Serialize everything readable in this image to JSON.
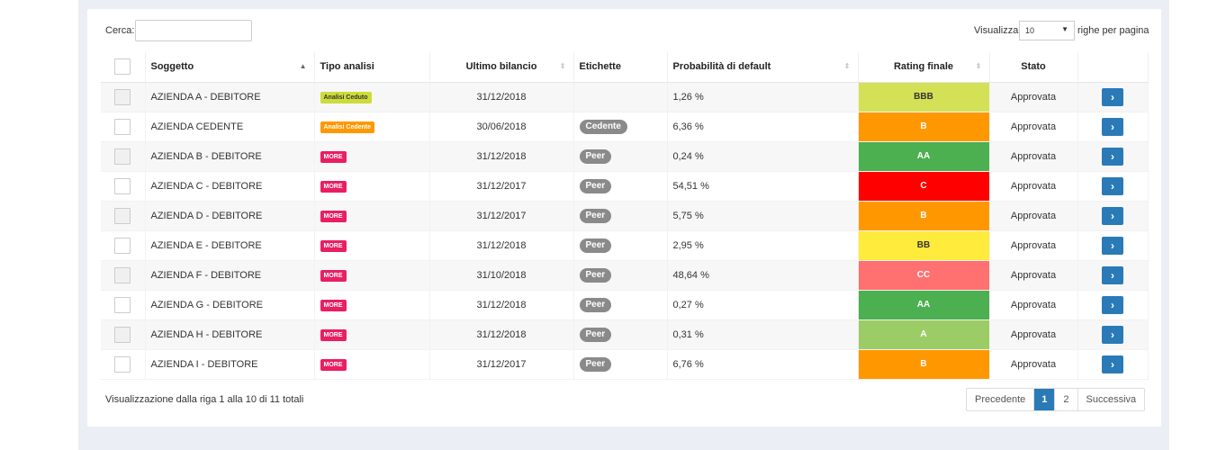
{
  "search": {
    "label": "Cerca:",
    "value": "",
    "placeholder": ""
  },
  "page_size": {
    "prefix": "Visualizza",
    "value": "10",
    "suffix": "righe per pagina"
  },
  "columns": {
    "soggetto": "Soggetto",
    "tipo": "Tipo analisi",
    "bilancio": "Ultimo bilancio",
    "etichette": "Etichette",
    "prob": "Probabilità di default",
    "rating": "Rating finale",
    "stato": "Stato"
  },
  "rows": [
    {
      "soggetto": "AZIENDA A - DEBITORE",
      "tipo": "Analisi Ceduto",
      "tipo_color": "#cddc39",
      "bilancio": "31/12/2018",
      "etichetta": "",
      "prob": "1,26 %",
      "rating": "BBB",
      "rating_color": "#d4e157",
      "rating_text": "#333333",
      "stato": "Approvata"
    },
    {
      "soggetto": "AZIENDA CEDENTE",
      "tipo": "Analisi Cedente",
      "tipo_color": "#ff9800",
      "bilancio": "30/06/2018",
      "etichetta": "Cedente",
      "prob": "6,36 %",
      "rating": "B",
      "rating_color": "#ff9800",
      "rating_text": "#ffffff",
      "stato": "Approvata"
    },
    {
      "soggetto": "AZIENDA B - DEBITORE",
      "tipo": "MORE",
      "tipo_color": "#e91e63",
      "bilancio": "31/12/2018",
      "etichetta": "Peer",
      "prob": "0,24 %",
      "rating": "AA",
      "rating_color": "#4caf50",
      "rating_text": "#ffffff",
      "stato": "Approvata"
    },
    {
      "soggetto": "AZIENDA C - DEBITORE",
      "tipo": "MORE",
      "tipo_color": "#e91e63",
      "bilancio": "31/12/2017",
      "etichetta": "Peer",
      "prob": "54,51 %",
      "rating": "C",
      "rating_color": "#ff0000",
      "rating_text": "#ffffff",
      "stato": "Approvata"
    },
    {
      "soggetto": "AZIENDA D - DEBITORE",
      "tipo": "MORE",
      "tipo_color": "#e91e63",
      "bilancio": "31/12/2017",
      "etichetta": "Peer",
      "prob": "5,75 %",
      "rating": "B",
      "rating_color": "#ff9800",
      "rating_text": "#ffffff",
      "stato": "Approvata"
    },
    {
      "soggetto": "AZIENDA E - DEBITORE",
      "tipo": "MORE",
      "tipo_color": "#e91e63",
      "bilancio": "31/12/2018",
      "etichetta": "Peer",
      "prob": "2,95 %",
      "rating": "BB",
      "rating_color": "#ffeb3b",
      "rating_text": "#333333",
      "stato": "Approvata"
    },
    {
      "soggetto": "AZIENDA F - DEBITORE",
      "tipo": "MORE",
      "tipo_color": "#e91e63",
      "bilancio": "31/10/2018",
      "etichetta": "Peer",
      "prob": "48,64 %",
      "rating": "CC",
      "rating_color": "#ff7070",
      "rating_text": "#ffffff",
      "stato": "Approvata"
    },
    {
      "soggetto": "AZIENDA G - DEBITORE",
      "tipo": "MORE",
      "tipo_color": "#e91e63",
      "bilancio": "31/12/2018",
      "etichetta": "Peer",
      "prob": "0,27 %",
      "rating": "AA",
      "rating_color": "#4caf50",
      "rating_text": "#ffffff",
      "stato": "Approvata"
    },
    {
      "soggetto": "AZIENDA H - DEBITORE",
      "tipo": "MORE",
      "tipo_color": "#e91e63",
      "bilancio": "31/12/2018",
      "etichetta": "Peer",
      "prob": "0,31 %",
      "rating": "A",
      "rating_color": "#9ccc65",
      "rating_text": "#ffffff",
      "stato": "Approvata"
    },
    {
      "soggetto": "AZIENDA I - DEBITORE",
      "tipo": "MORE",
      "tipo_color": "#e91e63",
      "bilancio": "31/12/2017",
      "etichetta": "Peer",
      "prob": "6,76 %",
      "rating": "B",
      "rating_color": "#ff9800",
      "rating_text": "#ffffff",
      "stato": "Approvata"
    }
  ],
  "row_action_icon": "chevron-right-icon",
  "footer": {
    "summary": "Visualizzazione dalla riga 1 alla 10 di 11 totali"
  },
  "pagination": {
    "prev": "Precedente",
    "pages": [
      "1",
      "2"
    ],
    "current": "1",
    "next": "Successiva"
  },
  "colors": {
    "accent": "#2a7ab8",
    "background": "#ebeef4"
  }
}
